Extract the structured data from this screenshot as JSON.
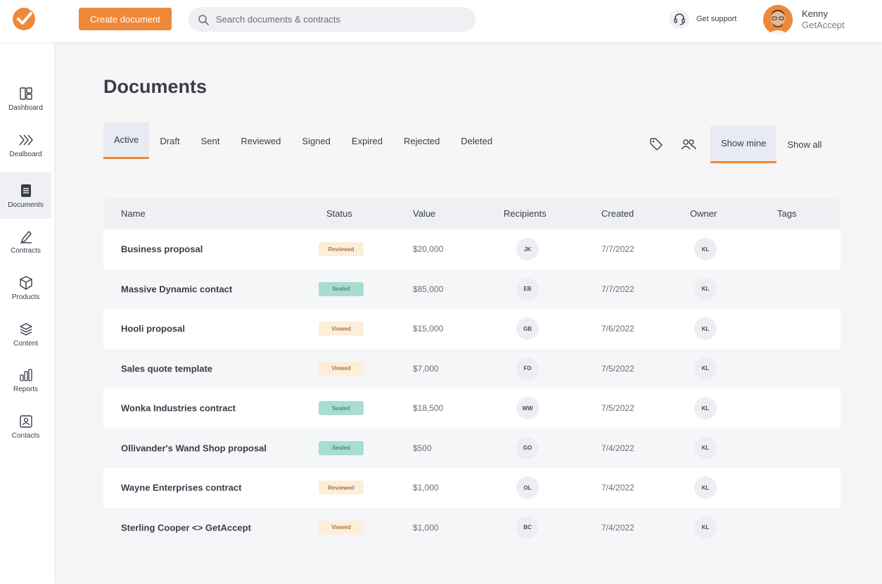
{
  "topbar": {
    "create_label": "Create document",
    "search_placeholder": "Search documents & contracts",
    "support_label": "Get support",
    "user_name": "Kenny",
    "user_org": "GetAccept"
  },
  "colors": {
    "accent": "#f0883a",
    "sealed": "#a8ddd0",
    "pending": "#fdeed9"
  },
  "sidebar": {
    "items": [
      {
        "label": "Dashboard",
        "icon": "dashboard-icon",
        "active": false
      },
      {
        "label": "Dealboard",
        "icon": "dealboard-icon",
        "active": false
      },
      {
        "label": "Documents",
        "icon": "document-icon",
        "active": true
      },
      {
        "label": "Contracts",
        "icon": "pen-icon",
        "active": false
      },
      {
        "label": "Products",
        "icon": "box-icon",
        "active": false
      },
      {
        "label": "Content",
        "icon": "layers-icon",
        "active": false
      },
      {
        "label": "Reports",
        "icon": "bar-chart-icon",
        "active": false
      },
      {
        "label": "Contacts",
        "icon": "contact-card-icon",
        "active": false
      }
    ]
  },
  "main": {
    "title": "Documents",
    "tabs": [
      "Active",
      "Draft",
      "Sent",
      "Reviewed",
      "Signed",
      "Expired",
      "Rejected",
      "Deleted"
    ],
    "active_tab": "Active",
    "show_mine_label": "Show mine",
    "show_all_label": "Show all"
  },
  "table": {
    "columns": [
      "Name",
      "Status",
      "Value",
      "Recipients",
      "Created",
      "Owner",
      "Tags"
    ],
    "rows": [
      {
        "name": "Business proposal",
        "status": "Reviewed",
        "value": "$20,000",
        "recipient": "JK",
        "created": "7/7/2022",
        "owner": "KL"
      },
      {
        "name": "Massive Dynamic contact",
        "status": "Sealed",
        "value": "$85,000",
        "recipient": "EB",
        "created": "7/7/2022",
        "owner": "KL"
      },
      {
        "name": "Hooli proposal",
        "status": "Viewed",
        "value": "$15,000",
        "recipient": "GB",
        "created": "7/6/2022",
        "owner": "KL"
      },
      {
        "name": "Sales quote template",
        "status": "Viewed",
        "value": "$7,000",
        "recipient": "FO",
        "created": "7/5/2022",
        "owner": "KL"
      },
      {
        "name": "Wonka Industries contract",
        "status": "Sealed",
        "value": "$18,500",
        "recipient": "WW",
        "created": "7/5/2022",
        "owner": "KL"
      },
      {
        "name": "Ollivander's Wand Shop proposal",
        "status": "Sealed",
        "value": "$500",
        "recipient": "GO",
        "created": "7/4/2022",
        "owner": "KL"
      },
      {
        "name": "Wayne Enterprises contract",
        "status": "Reviewed",
        "value": "$1,000",
        "recipient": "OL",
        "created": "7/4/2022",
        "owner": "KL"
      },
      {
        "name": "Sterling Cooper <> GetAccept",
        "status": "Viewed",
        "value": "$1,000",
        "recipient": "BC",
        "created": "7/4/2022",
        "owner": "KL"
      }
    ]
  }
}
